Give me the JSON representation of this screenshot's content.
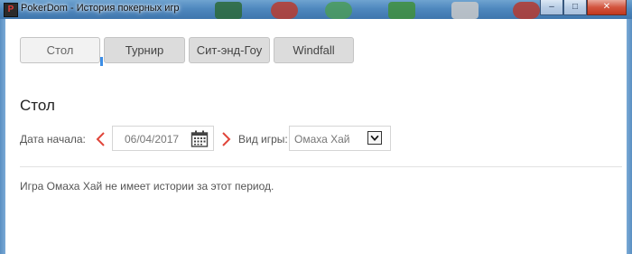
{
  "window": {
    "app_icon_letter": "P",
    "title": "PokerDom - История покерных игр",
    "buttons": {
      "minimize": "–",
      "maximize": "□",
      "close": "✕"
    }
  },
  "tabs": [
    {
      "label": "Стол",
      "active": true
    },
    {
      "label": "Турнир",
      "active": false
    },
    {
      "label": "Сит-энд-Гоу",
      "active": false
    },
    {
      "label": "Windfall",
      "active": false
    }
  ],
  "section_title": "Стол",
  "filters": {
    "start_date_label": "Дата начала:",
    "start_date_value": "06/04/2017",
    "game_type_label": "Вид игры:",
    "game_type_value": "Омаха Хай",
    "icons": {
      "prev": "chevron-left-icon",
      "next": "chevron-right-icon",
      "calendar": "calendar-icon",
      "dropdown": "chevron-down-icon"
    }
  },
  "message": "Игра Омаха Хай не имеет истории за этот период.",
  "colors": {
    "accent_arrow": "#e0453a",
    "tab_marker": "#3d8ee6",
    "titlebar": "#4f88be"
  }
}
